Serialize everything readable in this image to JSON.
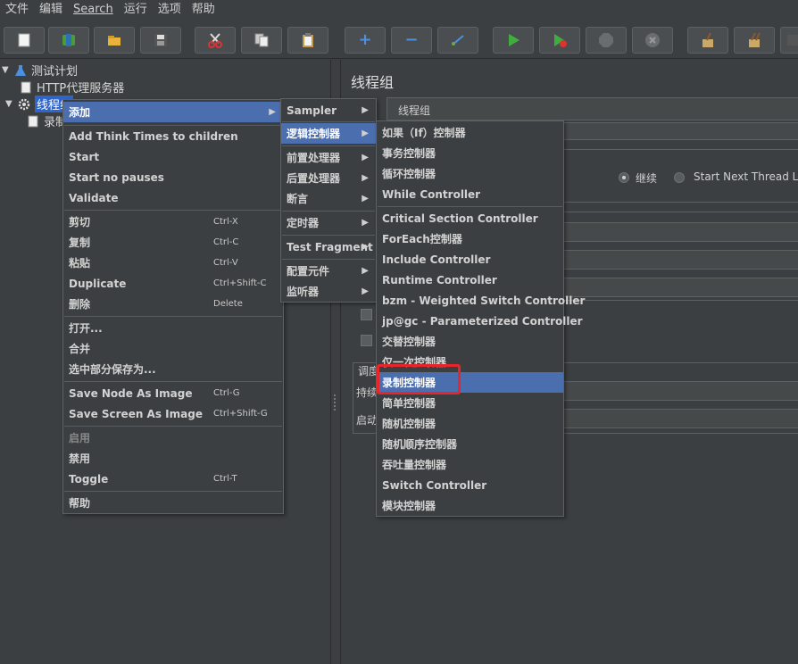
{
  "menubar": {
    "file": "文件",
    "edit": "编辑",
    "search": "Search",
    "run": "运行",
    "options": "选项",
    "help": "帮助"
  },
  "toolbar_icons": [
    "new-icon",
    "templates-icon",
    "open-icon",
    "save-icon",
    "cut-icon",
    "copy-icon",
    "paste-icon",
    "expand-icon",
    "collapse-icon",
    "toggle-icon",
    "start-icon",
    "start-no-pauses-icon",
    "stop-icon",
    "shutdown-icon",
    "clear-icon",
    "clear-all-icon"
  ],
  "tree": {
    "test_plan": "测试计划",
    "http_proxy": "HTTP代理服务器",
    "thread_group": "线程组",
    "recorder": "录制"
  },
  "right_panel": {
    "title": "线程组",
    "name_value": "线程组",
    "radio_continue": "继续",
    "radio_next_loop": "Start Next Thread Lo",
    "scheduler_label": "调度",
    "duration_label": "持续",
    "startup_label": "启动"
  },
  "context_menu": {
    "add": "添加",
    "add_think": "Add Think Times to children",
    "start": "Start",
    "start_no_pauses": "Start no pauses",
    "validate": "Validate",
    "cut": "剪切",
    "cut_key": "Ctrl-X",
    "copy": "复制",
    "copy_key": "Ctrl-C",
    "paste": "粘贴",
    "paste_key": "Ctrl-V",
    "duplicate": "Duplicate",
    "duplicate_key": "Ctrl+Shift-C",
    "delete": "删除",
    "delete_key": "Delete",
    "open": "打开...",
    "merge": "合并",
    "save_selection": "选中部分保存为...",
    "save_node_image": "Save Node As Image",
    "save_node_image_key": "Ctrl-G",
    "save_screen_image": "Save Screen As Image",
    "save_screen_image_key": "Ctrl+Shift-G",
    "enable": "启用",
    "disable": "禁用",
    "toggle": "Toggle",
    "toggle_key": "Ctrl-T",
    "help": "帮助"
  },
  "add_menu": {
    "sampler": "Sampler",
    "logic_controller": "逻辑控制器",
    "pre_processor": "前置处理器",
    "post_processor": "后置处理器",
    "assertion": "断言",
    "timer": "定时器",
    "test_fragment": "Test Fragment",
    "config_element": "配置元件",
    "listener": "监听器"
  },
  "logic_menu": [
    "如果（If）控制器",
    "事务控制器",
    "循环控制器",
    "While Controller",
    "Critical Section Controller",
    "ForEach控制器",
    "Include Controller",
    "Runtime Controller",
    "bzm - Weighted Switch Controller",
    "jp@gc - Parameterized Controller",
    "交替控制器",
    "仅一次控制器",
    "录制控制器",
    "简单控制器",
    "随机控制器",
    "随机顺序控制器",
    "吞吐量控制器",
    "Switch Controller",
    "模块控制器"
  ],
  "highlight_color": "#4b6eaf",
  "annotation_color": "#e8262a"
}
